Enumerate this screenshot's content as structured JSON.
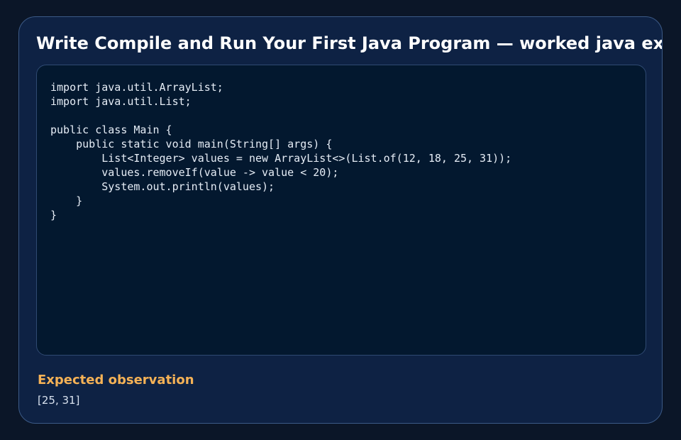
{
  "card": {
    "title": "Write Compile and Run Your First Java Program — worked java example",
    "code_lines": [
      "import java.util.ArrayList;",
      "import java.util.List;",
      "",
      "public class Main {",
      "    public static void main(String[] args) {",
      "        List<Integer> values = new ArrayList<>(List.of(12, 18, 25, 31));",
      "        values.removeIf(value -> value < 20);",
      "        System.out.println(values);",
      "    }",
      "}"
    ],
    "observation": {
      "heading": "Expected observation",
      "value": "[25, 31]"
    }
  },
  "colors": {
    "page_background": "#0b1628",
    "card_background": "#0e2244",
    "code_background": "#03182f",
    "title_text": "#ffffff",
    "observation_heading": "#f5b256"
  }
}
